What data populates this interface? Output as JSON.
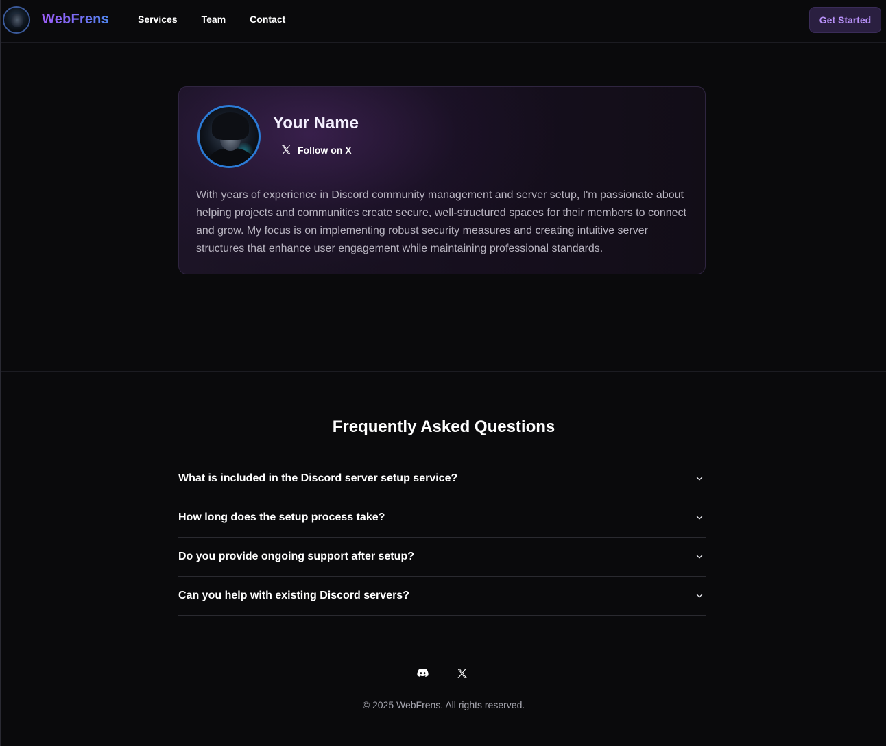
{
  "nav": {
    "brand": "WebFrens",
    "links": [
      "Services",
      "Team",
      "Contact"
    ],
    "cta": "Get Started"
  },
  "profile": {
    "name": "Your Name",
    "follow_label": "Follow on X",
    "bio": "With years of experience in Discord community management and server setup, I'm passionate about helping projects and communities create secure, well-structured spaces for their members to connect and grow. My focus is on implementing robust security measures and creating intuitive server structures that enhance user engagement while maintaining professional standards."
  },
  "faq": {
    "title": "Frequently Asked Questions",
    "items": [
      "What is included in the Discord server setup service?",
      "How long does the setup process take?",
      "Do you provide ongoing support after setup?",
      "Can you help with existing Discord servers?"
    ]
  },
  "footer": {
    "icons": [
      "discord-icon",
      "x-icon"
    ],
    "copyright": "© 2025 WebFrens. All rights reserved."
  },
  "colors": {
    "background": "#0a0a0c",
    "brand_gradient_start": "#9b5cf6",
    "brand_gradient_end": "#4f86f0",
    "cta_text": "#b790f7",
    "avatar_ring": "#2b7bd6"
  }
}
